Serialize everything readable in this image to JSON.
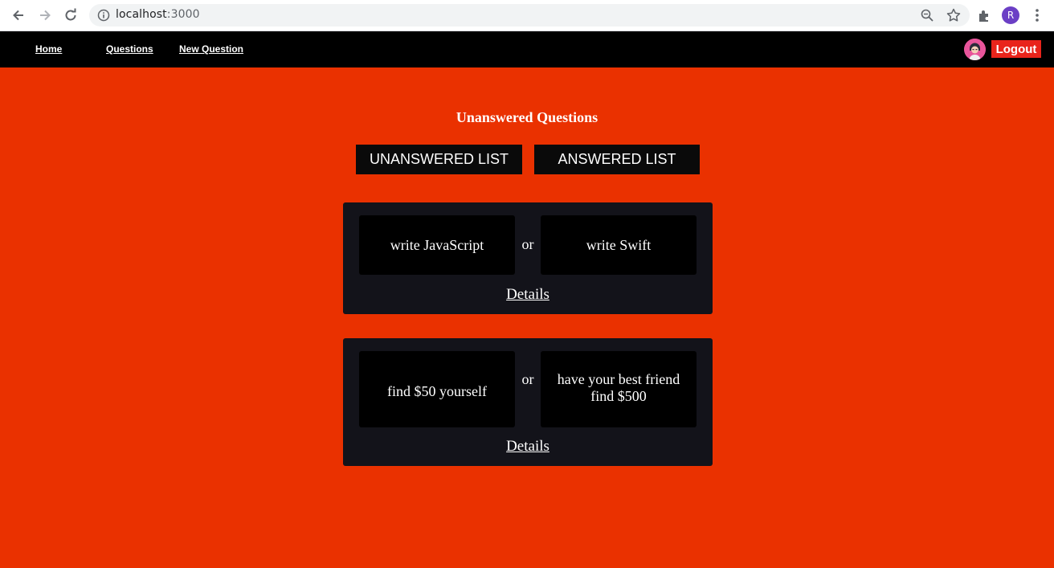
{
  "browser": {
    "url_host": "localhost",
    "url_port": ":3000",
    "profile_initial": "R"
  },
  "nav": {
    "home": "Home",
    "questions": "Questions",
    "new_question": "New Question",
    "logout": "Logout"
  },
  "main": {
    "title": "Unanswered Questions",
    "unanswered_btn": "UNANSWERED LIST",
    "answered_btn": "ANSWERED LIST",
    "or_label": "or",
    "details_label": "Details",
    "questions": [
      {
        "option_one": "write JavaScript",
        "option_two": "write Swift"
      },
      {
        "option_one": "find $50 yourself",
        "option_two": "have your best friend find $500"
      }
    ]
  },
  "colors": {
    "page_bg": "#ea3100",
    "navbar_bg": "#000000",
    "card_bg": "#13131a",
    "logout_bg": "#e9241b"
  }
}
